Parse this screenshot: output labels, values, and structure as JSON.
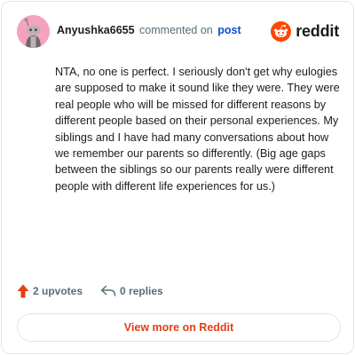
{
  "header": {
    "username": "Anyushka6655",
    "action_text": "commented on",
    "post_link": "post",
    "brand_name": "reddit"
  },
  "comment": {
    "text": "NTA, no one is perfect. I seriously don't get why eulogies are supposed to make it sound like they were. They were real people who will be missed for different reasons by different people based on their personal experiences. My siblings and I have had many conversations about how we remember our parents so differently. (Big age gaps between the siblings so our parents really were different people with different life experiences for us.)"
  },
  "actions": {
    "upvotes_label": "2 upvotes",
    "replies_label": "0 replies"
  },
  "footer": {
    "view_more_label": "View more on Reddit"
  },
  "icons": {
    "avatar": "snoo-avatar-icon",
    "brand": "reddit-logo-icon",
    "upvote": "upvote-arrow-icon",
    "reply": "reply-arrow-icon"
  },
  "colors": {
    "brand_orange": "#ff4500",
    "upvote_orange": "#e5400e",
    "link_blue": "#0a4fd6",
    "view_more_text": "#e0401b",
    "avatar_pink": "#f3a3bf",
    "muted_text": "#576f76"
  }
}
